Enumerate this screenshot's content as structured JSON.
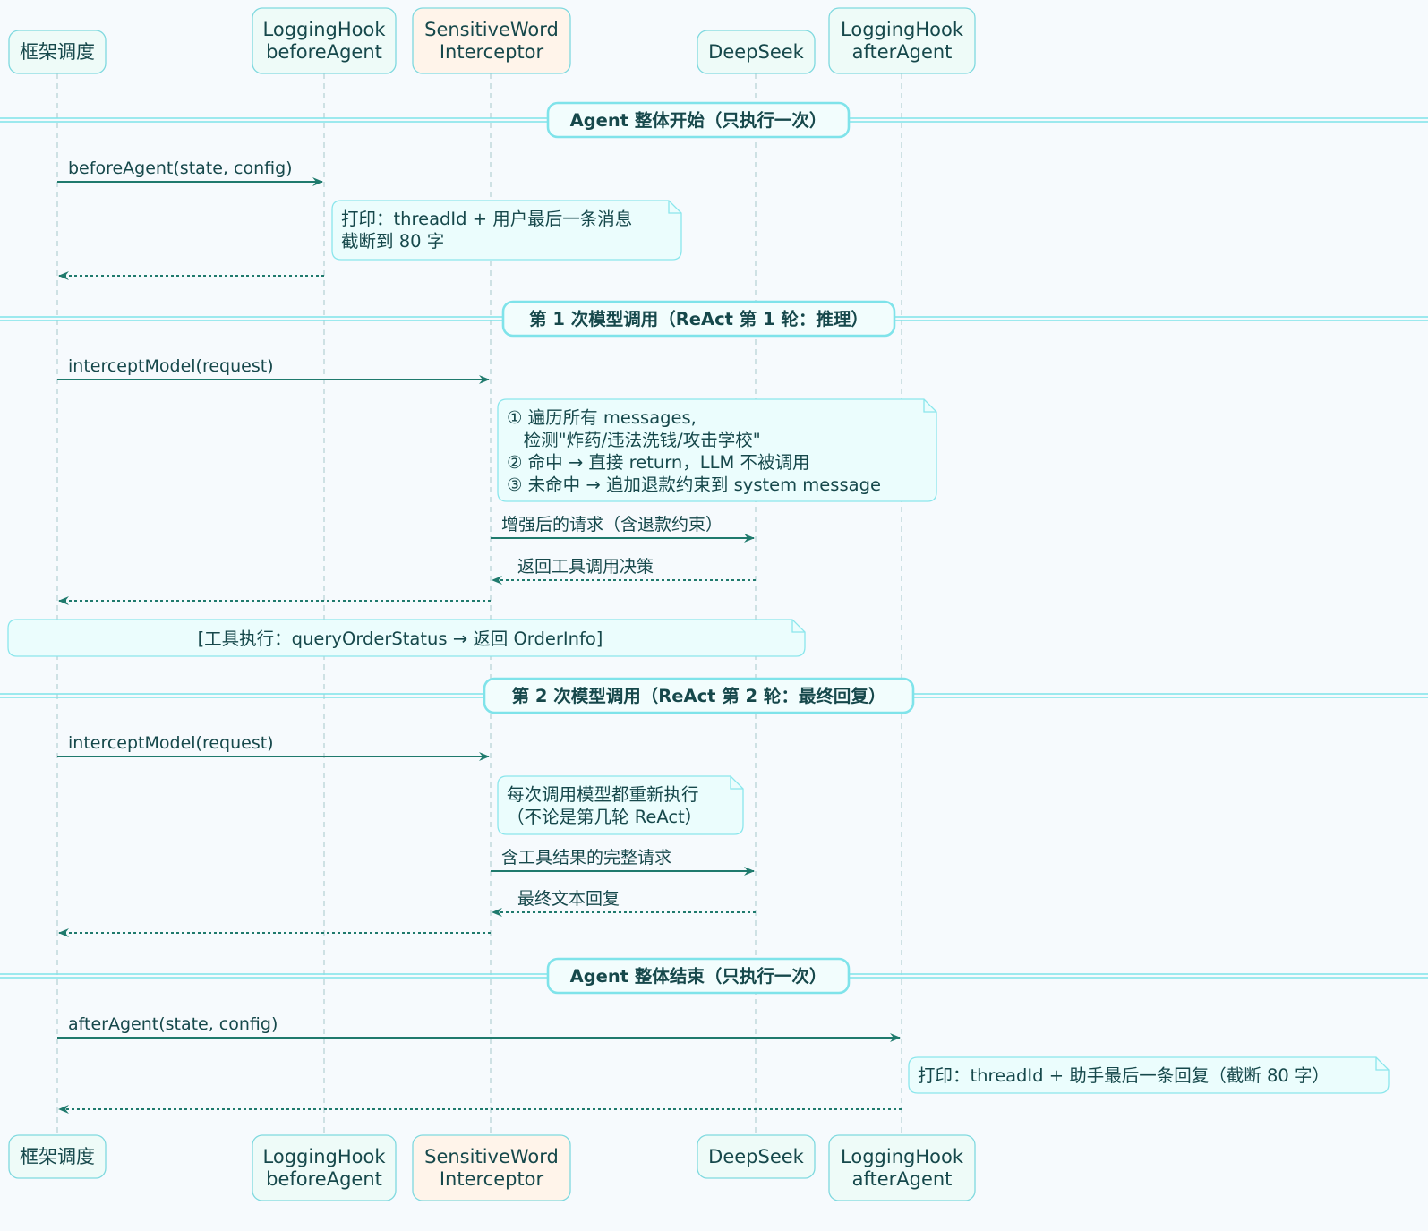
{
  "colors": {
    "background": "#f6fafd",
    "line": "#1f7a6d",
    "lifeline": "#b8d4d8",
    "participant_fill": "#eefbf8",
    "participant_alt_fill": "#fff4ea",
    "participant_border": "#7fd9df",
    "note_fill": "#ebfdfd",
    "note_border": "#8be6ec",
    "divider": "#7fe3ea",
    "text": "#16484b"
  },
  "participants": [
    {
      "id": "framework",
      "lines": [
        "框架调度"
      ],
      "highlight": false
    },
    {
      "id": "before",
      "lines": [
        "LoggingHook",
        "beforeAgent"
      ],
      "highlight": false
    },
    {
      "id": "sensitive",
      "lines": [
        "SensitiveWord",
        "Interceptor"
      ],
      "highlight": true
    },
    {
      "id": "deepseek",
      "lines": [
        "DeepSeek"
      ],
      "highlight": false
    },
    {
      "id": "after",
      "lines": [
        "LoggingHook",
        "afterAgent"
      ],
      "highlight": false
    }
  ],
  "dividers": [
    {
      "label": "Agent 整体开始（只执行一次）"
    },
    {
      "label": "第 1 次模型调用（ReAct 第 1 轮：推理）"
    },
    {
      "label": "第 2 次模型调用（ReAct 第 2 轮：最终回复）"
    },
    {
      "label": "Agent 整体结束（只执行一次）"
    }
  ],
  "messages": [
    {
      "from": "framework",
      "to": "before",
      "label": "beforeAgent(state, config)",
      "dashed": false
    },
    {
      "from": "before",
      "to": "framework",
      "label": "",
      "dashed": true
    },
    {
      "from": "framework",
      "to": "sensitive",
      "label": "interceptModel(request)",
      "dashed": false
    },
    {
      "from": "sensitive",
      "to": "deepseek",
      "label": "增强后的请求（含退款约束）",
      "dashed": false
    },
    {
      "from": "deepseek",
      "to": "sensitive",
      "label": "返回工具调用决策",
      "dashed": true
    },
    {
      "from": "sensitive",
      "to": "framework",
      "label": "",
      "dashed": true
    },
    {
      "from": "framework",
      "to": "sensitive",
      "label": "interceptModel(request)",
      "dashed": false
    },
    {
      "from": "sensitive",
      "to": "deepseek",
      "label": "含工具结果的完整请求",
      "dashed": false
    },
    {
      "from": "deepseek",
      "to": "sensitive",
      "label": "最终文本回复",
      "dashed": true
    },
    {
      "from": "sensitive",
      "to": "framework",
      "label": "",
      "dashed": true
    },
    {
      "from": "framework",
      "to": "after",
      "label": "afterAgent(state, config)",
      "dashed": false
    },
    {
      "from": "after",
      "to": "framework",
      "label": "",
      "dashed": true
    }
  ],
  "notes": [
    {
      "lines": [
        "打印：threadId + 用户最后一条消息",
        "截断到 80 字"
      ]
    },
    {
      "lines": [
        "① 遍历所有 messages,",
        "   检测\"炸药/违法洗钱/攻击学校\"",
        "② 命中 → 直接 return，LLM 不被调用",
        "③ 未命中 → 追加退款约束到 system message"
      ]
    },
    {
      "lines": [
        "[工具执行：queryOrderStatus → 返回 OrderInfo]"
      ]
    },
    {
      "lines": [
        "每次调用模型都重新执行",
        "（不论是第几轮 ReAct）"
      ]
    },
    {
      "lines": [
        "打印：threadId + 助手最后一条回复（截断 80 字）"
      ]
    }
  ]
}
